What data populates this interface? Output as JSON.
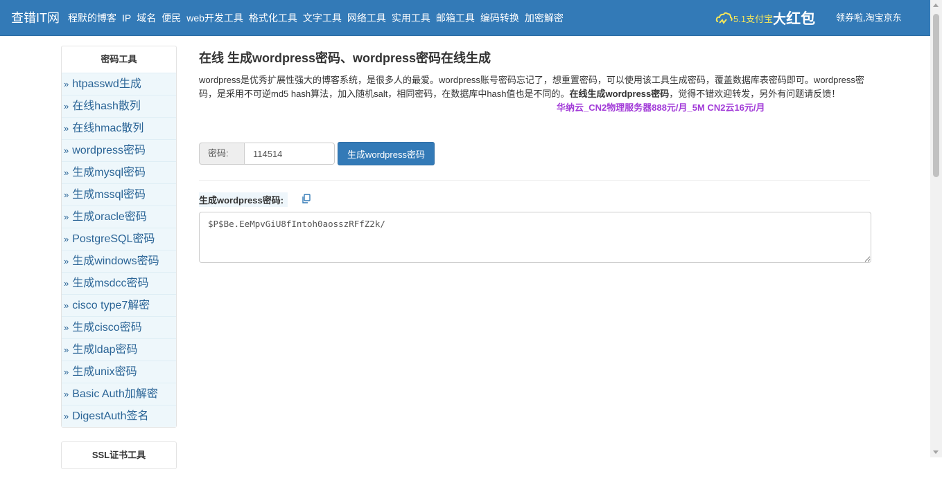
{
  "navbar": {
    "brand": "查错IT网",
    "items": [
      "程默的博客",
      "IP",
      "域名",
      "便民",
      "web开发工具",
      "格式化工具",
      "文字工具",
      "网络工具",
      "实用工具",
      "邮箱工具",
      "编码转换",
      "加密解密"
    ],
    "promo_small": "5.1支付宝",
    "promo_big": "大",
    "promo_bigger": "红包",
    "right_link": "领券啦,淘宝京东"
  },
  "sidebar": {
    "panel_title": "密码工具",
    "items": [
      "htpasswd生成",
      "在线hash散列",
      "在线hmac散列",
      "wordpress密码",
      "生成mysql密码",
      "生成mssql密码",
      "生成oracle密码",
      "PostgreSQL密码",
      "生成windows密码",
      "生成msdcc密码",
      "cisco type7解密",
      "生成cisco密码",
      "生成ldap密码",
      "生成unix密码",
      "Basic Auth加解密",
      "DigestAuth签名"
    ],
    "bullet": "»",
    "panel2_title": "SSL证书工具"
  },
  "main": {
    "title": "在线 生成wordpress密码、wordpress密码在线生成",
    "desc_part1": "wordpress是优秀扩展性强大的博客系统，是很多人的最爱。wordpress账号密码忘记了，想重置密码，可以使用该工具生成密码，覆盖数据库表密码即可。wordpress密码，是采用不可逆md5 hash算法，加入随机salt，相同密码，在数据库中hash值也是不同的。",
    "desc_bold": "在线生成wordpress密码",
    "desc_part2": "，觉得不错欢迎转发，另外有问题请反馈！",
    "ad_text": "华纳云_CN2物理服务器888元/月_5M CN2云16元/月",
    "password_label": "密码:",
    "password_value": "114514",
    "generate_button": "生成wordpress密码",
    "result_label": "生成wordpress密码:",
    "result_value": "$P$Be.EeMpvGiU8fIntoh0aosszRFfZ2k/"
  },
  "colors": {
    "navbar": "#337ab7",
    "sidebar_item_bg": "#eef7fb",
    "link": "#2a6496",
    "ad": "#a23bd8",
    "button": "#337ab7"
  }
}
